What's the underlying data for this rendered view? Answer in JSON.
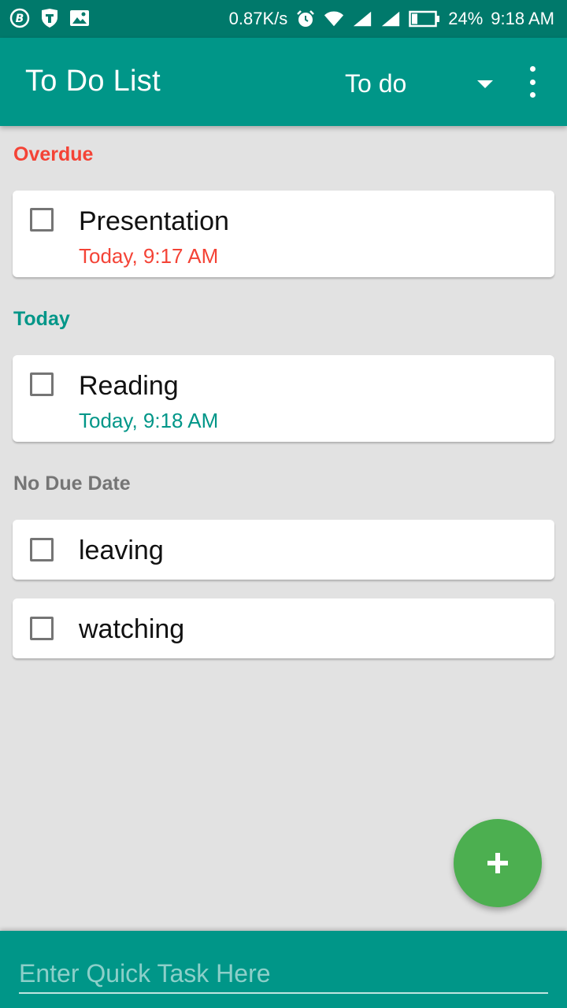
{
  "status_bar": {
    "net_speed": "0.87K/s",
    "battery": "24%",
    "time": "9:18 AM",
    "icons": [
      "b-app-icon",
      "shield-icon",
      "image-icon",
      "alarm-icon",
      "wifi-icon",
      "signal-icon",
      "signal-icon",
      "battery-icon"
    ]
  },
  "app_bar": {
    "title": "To Do List",
    "filter_value": "To do",
    "color": "#009688"
  },
  "sections": [
    {
      "header": "Overdue",
      "color": "#f44336",
      "tasks": [
        {
          "title": "Presentation",
          "due": "Today, 9:17 AM",
          "checked": false
        }
      ]
    },
    {
      "header": "Today",
      "color": "#009688",
      "tasks": [
        {
          "title": "Reading",
          "due": "Today, 9:18 AM",
          "checked": false
        }
      ]
    },
    {
      "header": "No Due Date",
      "color": "#757575",
      "tasks": [
        {
          "title": "leaving",
          "checked": false
        },
        {
          "title": "watching",
          "checked": false
        }
      ]
    }
  ],
  "fab": {
    "icon": "plus-icon",
    "color": "#4caf50"
  },
  "quick_task": {
    "placeholder": "Enter Quick Task Here",
    "value": ""
  }
}
